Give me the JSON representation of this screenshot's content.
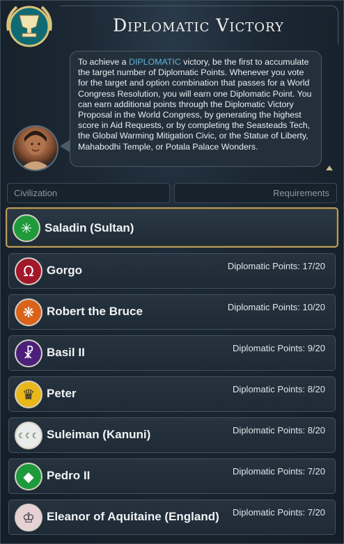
{
  "header": {
    "title": "Diplomatic Victory",
    "emblem_icon": "laurel-trophy-icon"
  },
  "description": {
    "before_keyword": "To achieve a ",
    "keyword": "DIPLOMATIC",
    "after_keyword": " victory, be the first to accumulate the target number of Diplomatic Points. Whenever you vote for the target and option combination that passes for a World Congress Resolution, you will earn one Diplomatic Point.  You can earn additional points through the Diplomatic Victory Proposal in the World Congress, by generating the highest score in Aid Requests, or by completing the Seasteads Tech, the Global Warming Mitigation Civic, or the Statue of Liberty, Mahabodhi Temple, or Potala Palace Wonders.",
    "keyword_color": "#5fb6d9"
  },
  "columns": {
    "civilization": "Civilization",
    "requirements": "Requirements"
  },
  "rows": [
    {
      "leader": "Saladin (Sultan)",
      "points": "",
      "icon": "palm-tree-icon",
      "icon_color": "#1f9a3a",
      "glyph": "✳"
    },
    {
      "leader": "Gorgo",
      "points": "Diplomatic Points: 17/20",
      "icon": "lambda-shield-icon",
      "icon_color": "#a3172a",
      "glyph": "Ω"
    },
    {
      "leader": "Robert the Bruce",
      "points": "Diplomatic Points: 10/20",
      "icon": "saltire-icon",
      "icon_color": "#d9631b",
      "glyph": "❋"
    },
    {
      "leader": "Basil II",
      "points": "Diplomatic Points: 9/20",
      "icon": "chi-rho-icon",
      "icon_color": "#4b1f7a",
      "glyph": "☧"
    },
    {
      "leader": "Peter",
      "points": "Diplomatic Points: 8/20",
      "icon": "double-eagle-icon",
      "icon_color": "#e8b71a",
      "glyph": "♛"
    },
    {
      "leader": "Suleiman (Kanuni)",
      "points": "Diplomatic Points: 8/20",
      "icon": "three-crescents-icon",
      "icon_color": "#e9ece8",
      "glyph": "☾☾☾"
    },
    {
      "leader": "Pedro II",
      "points": "Diplomatic Points: 7/20",
      "icon": "brazil-flag-icon",
      "icon_color": "#1e9a3c",
      "glyph": "◆"
    },
    {
      "leader": "Eleanor of Aquitaine (England)",
      "points": "Diplomatic Points: 7/20",
      "icon": "crown-icon",
      "icon_color": "#e7d1d4",
      "glyph": "♔"
    }
  ]
}
